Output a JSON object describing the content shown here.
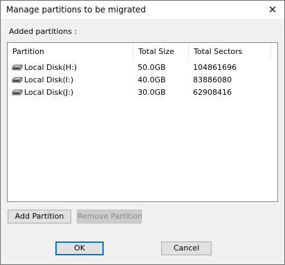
{
  "window": {
    "title": "Manage partitions to be migrated",
    "close_glyph": "✕"
  },
  "section_label": "Added partitions :",
  "table": {
    "columns": [
      "Partition",
      "Total Size",
      "Total Sectors"
    ],
    "rows": [
      {
        "icon": "disk-icon",
        "partition": "Local Disk(H:)",
        "size": "50.0GB",
        "sectors": "104861696"
      },
      {
        "icon": "disk-icon",
        "partition": "Local Disk(I:)",
        "size": "40.0GB",
        "sectors": "83886080"
      },
      {
        "icon": "disk-icon",
        "partition": "Local Disk(J:)",
        "size": "30.0GB",
        "sectors": "62908416"
      }
    ]
  },
  "buttons": {
    "add_partition": "Add Partition",
    "remove_partition": "Remove Partition",
    "ok": "OK",
    "cancel": "Cancel"
  },
  "colors": {
    "dialog_bg": "#f0f0f0",
    "default_button_border": "#0078d7"
  }
}
